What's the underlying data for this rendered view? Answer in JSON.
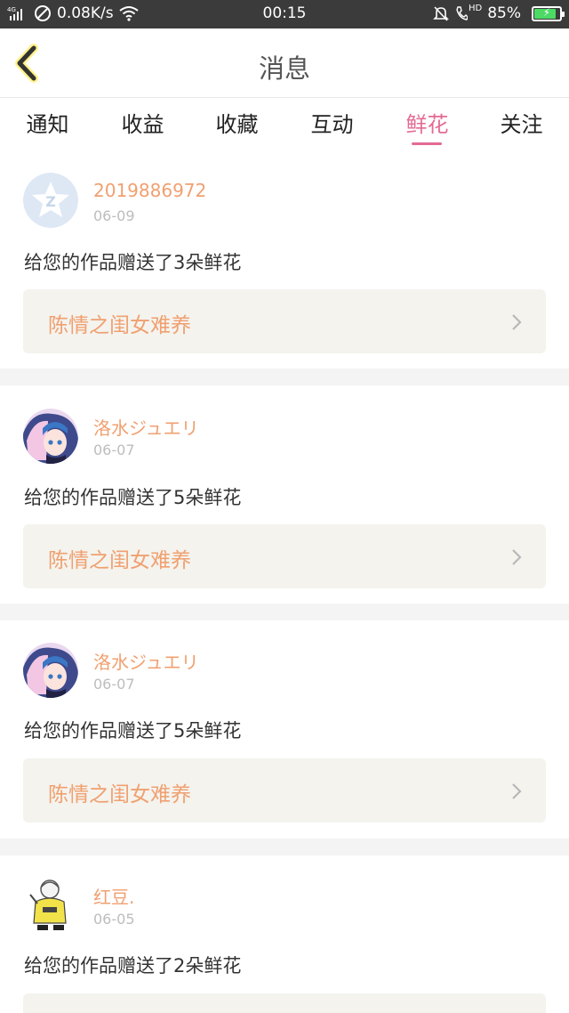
{
  "status_bar": {
    "network": "4G",
    "speed": "0.08K/s",
    "time": "00:15",
    "hd": "HD",
    "battery_percent_text": "85%",
    "battery_level": 0.85
  },
  "header": {
    "title": "消息"
  },
  "tabs": [
    {
      "label": "通知"
    },
    {
      "label": "收益"
    },
    {
      "label": "收藏"
    },
    {
      "label": "互动"
    },
    {
      "label": "鲜花"
    },
    {
      "label": "关注"
    }
  ],
  "active_tab": "鲜花",
  "colors": {
    "accent": "#e46a95",
    "username": "#f0a070",
    "card_bg": "#f4f3ee",
    "status_bar": "#3b3b3b"
  },
  "messages": [
    {
      "username": "2019886972",
      "date": "06-09",
      "text": "给您的作品赠送了3朵鲜花",
      "work": "陈情之闺女难养",
      "avatar": "default-avatar-icon"
    },
    {
      "username": "洛水ジュエリ",
      "date": "06-07",
      "text": "给您的作品赠送了5朵鲜花",
      "work": "陈情之闺女难养",
      "avatar": "anime-avatar"
    },
    {
      "username": "洛水ジュエリ",
      "date": "06-07",
      "text": "给您的作品赠送了5朵鲜花",
      "work": "陈情之闺女难养",
      "avatar": "anime-avatar"
    },
    {
      "username": "红豆.",
      "date": "06-05",
      "text": "给您的作品赠送了2朵鲜花",
      "work": "",
      "avatar": "sketch-avatar"
    }
  ]
}
